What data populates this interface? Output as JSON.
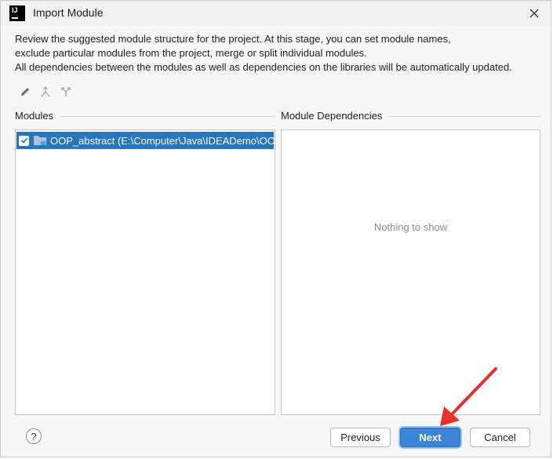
{
  "window": {
    "title": "Import Module",
    "app_icon_text": "IJ"
  },
  "description": {
    "line1": "Review the suggested module structure for the project. At this stage, you can set module names,",
    "line2": "exclude particular modules from the project, merge or split individual modules.",
    "line3": "All dependencies between the modules as well as dependencies on the libraries will be automatically updated."
  },
  "toolbar": {
    "icons": [
      "edit-icon",
      "merge-icon",
      "split-icon"
    ]
  },
  "modules": {
    "label": "Modules",
    "items": [
      {
        "label": "OOP_abstract (E:\\Computer\\Java\\IDEADemo\\OOP",
        "checked": true,
        "selected": true
      }
    ]
  },
  "dependencies": {
    "label": "Module Dependencies",
    "empty_text": "Nothing to show"
  },
  "footer": {
    "help_label": "?",
    "previous_label": "Previous",
    "next_label": "Next",
    "cancel_label": "Cancel"
  },
  "colors": {
    "selection": "#2675bf",
    "primary_button": "#3c84d8",
    "annotation_arrow": "#e8302a"
  }
}
